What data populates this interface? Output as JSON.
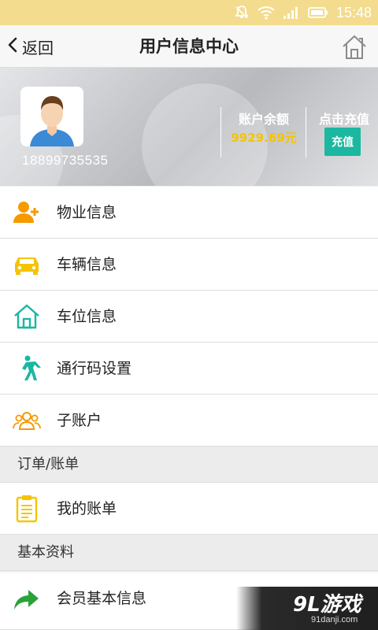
{
  "status_bar": {
    "time": "15:48"
  },
  "header": {
    "back_label": "返回",
    "title": "用户信息中心"
  },
  "profile": {
    "phone": "18899735535",
    "balance_label": "账户余额",
    "balance_value": "9929.69元",
    "recharge_label": "点击充值",
    "recharge_button": "充值"
  },
  "menu_group_1": [
    {
      "label": "物业信息",
      "icon": "add-user-icon"
    },
    {
      "label": "车辆信息",
      "icon": "car-icon"
    },
    {
      "label": "车位信息",
      "icon": "house-icon"
    },
    {
      "label": "通行码设置",
      "icon": "walking-person-icon"
    },
    {
      "label": "子账户",
      "icon": "group-users-icon"
    }
  ],
  "sections": {
    "orders_title": "订单/账单",
    "basic_title": "基本资料"
  },
  "menu_group_2": [
    {
      "label": "我的账单",
      "icon": "clipboard-icon"
    }
  ],
  "menu_group_3": [
    {
      "label": "会员基本信息",
      "icon": "share-arrow-icon"
    }
  ],
  "watermark": {
    "brand": "9L游戏",
    "site": "91danji.com"
  },
  "colors": {
    "status_bar": "#f3dc8e",
    "accent_orange": "#f59a00",
    "accent_yellow": "#f5c400",
    "accent_teal": "#1bb7a0",
    "accent_green": "#2aa23a"
  }
}
